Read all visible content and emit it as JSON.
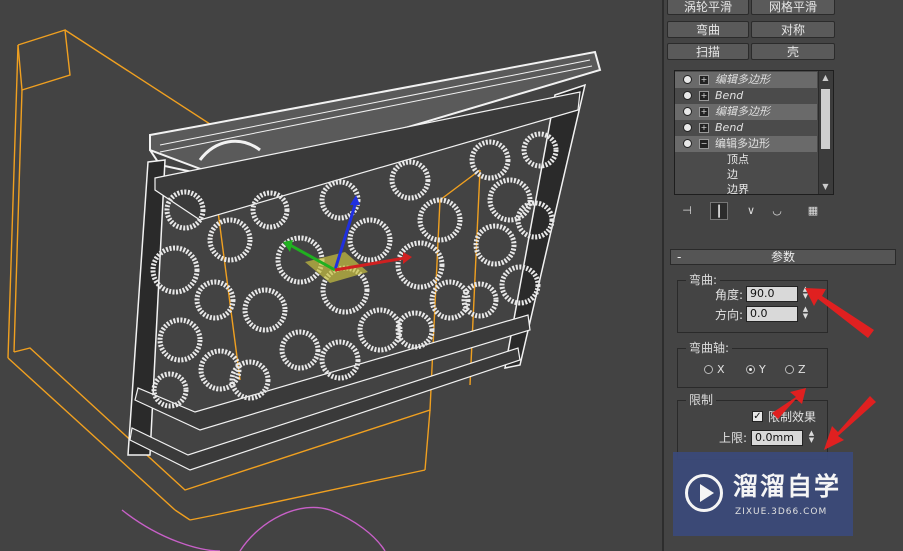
{
  "toolbar_buttons": {
    "row1_left": "涡轮平滑",
    "row1_right": "网格平滑",
    "row2_left": "弯曲",
    "row2_right": "对称",
    "row3_left": "扫描",
    "row3_right": "壳"
  },
  "modifier_stack": {
    "items": [
      {
        "label": "编辑多边形",
        "expander": "+"
      },
      {
        "label": "Bend",
        "expander": "+"
      },
      {
        "label": "编辑多边形",
        "expander": "+"
      },
      {
        "label": "Bend",
        "expander": "+"
      },
      {
        "label": "编辑多边形",
        "expander": "−"
      }
    ],
    "subobjects": [
      "顶点",
      "边",
      "边界"
    ]
  },
  "rollout": {
    "title": "参数",
    "collapse": "-",
    "bend_group": {
      "title": "弯曲:",
      "angle_label": "角度:",
      "angle_value": "90.0",
      "direction_label": "方向:",
      "direction_value": "0.0"
    },
    "axis_group": {
      "title": "弯曲轴:",
      "options": [
        "X",
        "Y",
        "Z"
      ],
      "selected": "Y"
    },
    "limits_group": {
      "title": "限制",
      "limit_effect_label": "限制效果",
      "limit_effect_checked": true,
      "upper_label": "上限:",
      "upper_value": "0.0mm"
    }
  },
  "logo": {
    "name": "溜溜自学",
    "url": "ZIXUE.3D66.COM"
  },
  "colors": {
    "selection_box": "#f0a020",
    "annotation_arrow": "#e02020",
    "viewport_bg": "#434343",
    "gizmo_x": "#d02020",
    "gizmo_y": "#20b020",
    "gizmo_z": "#2030e0"
  }
}
